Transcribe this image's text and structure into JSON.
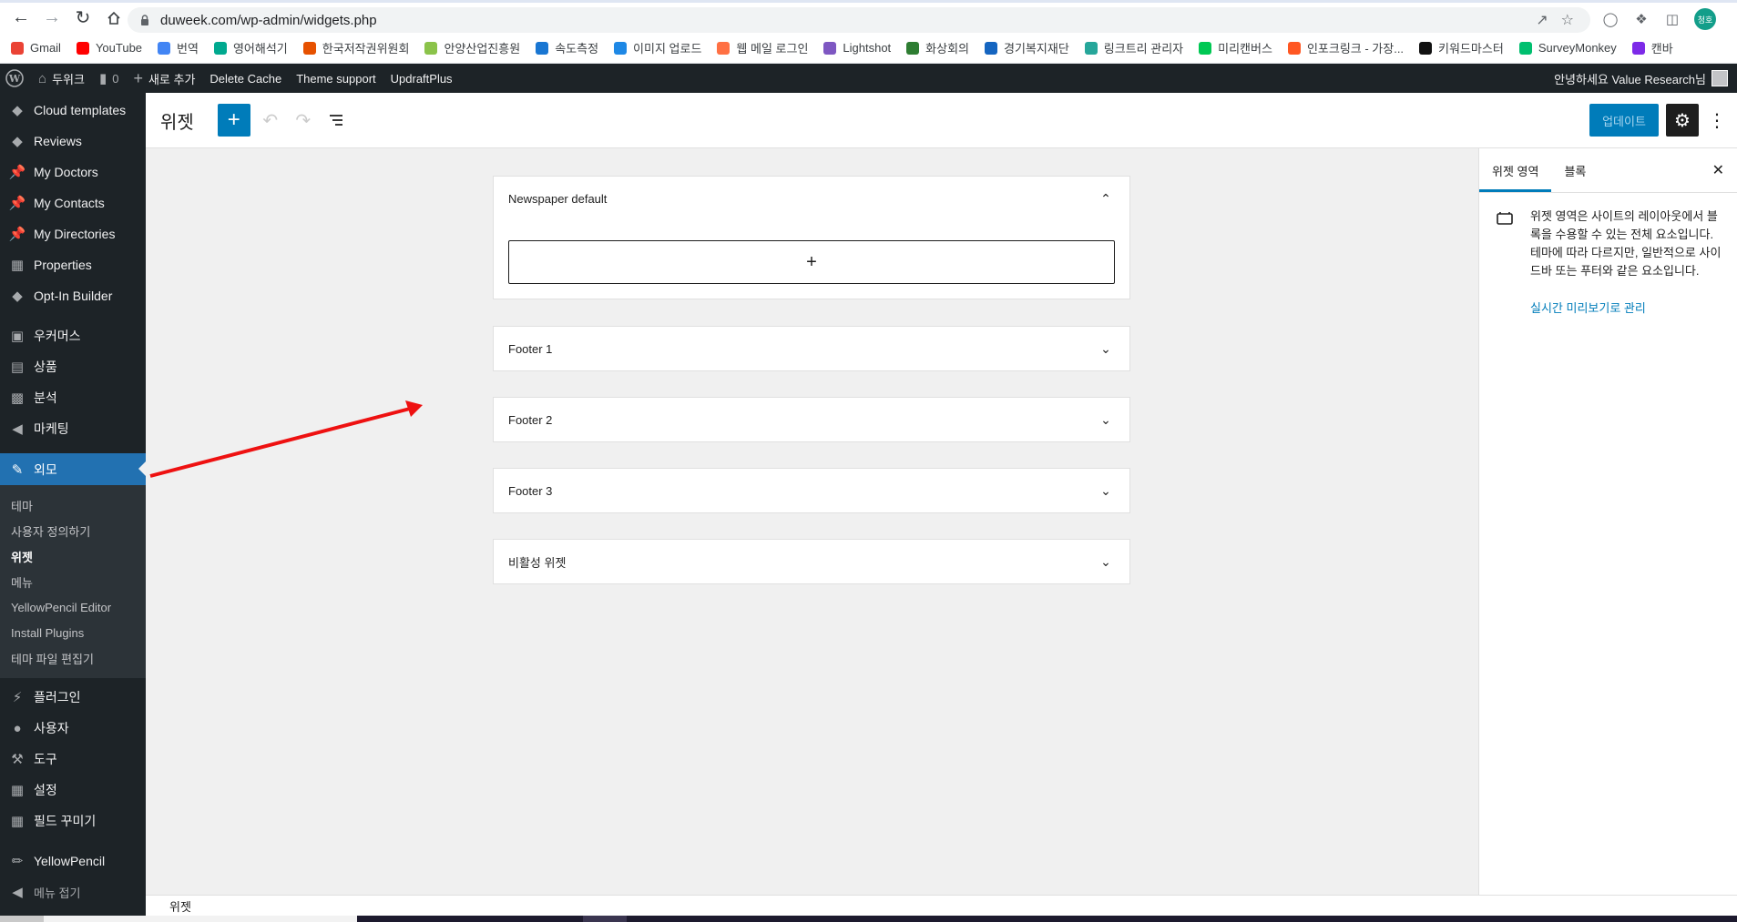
{
  "browser": {
    "url": "duweek.com/wp-admin/widgets.php",
    "bookmarks": [
      "Gmail",
      "YouTube",
      "번역",
      "영어해석기",
      "한국저작권위원회",
      "안양산업진흥원",
      "속도측정",
      "이미지 업로드",
      "웹 메일 로그인",
      "Lightshot",
      "화상회의",
      "경기복지재단",
      "링크트리 관리자",
      "미리캔버스",
      "인포크링크 - 가장...",
      "키워드마스터",
      "SurveyMonkey",
      "캔바"
    ],
    "bookmark_colors": [
      "#ea4335",
      "#ff0000",
      "#4285f4",
      "#00a98f",
      "#e65100",
      "#8bc34a",
      "#1976d2",
      "#1e88e5",
      "#ff7043",
      "#7e57c2",
      "#2e7d32",
      "#1565c0",
      "#26a69a",
      "#00c853",
      "#ff5722",
      "#111111",
      "#00bf6f",
      "#7d2ae8"
    ],
    "profile_initials": "청호"
  },
  "adminbar": {
    "site_name": "두위크",
    "comments": "0",
    "new": "새로 추가",
    "items": [
      "Delete Cache",
      "Theme support",
      "UpdraftPlus"
    ],
    "greeting": "안녕하세요 Value Research님"
  },
  "sidebar": {
    "top_items": [
      {
        "label": "Cloud templates",
        "icon": "diamond-icon"
      },
      {
        "label": "Reviews",
        "icon": "diamond-icon"
      },
      {
        "label": "My Doctors",
        "icon": "pin-icon"
      },
      {
        "label": "My Contacts",
        "icon": "pin-icon"
      },
      {
        "label": "My Directories",
        "icon": "pin-icon"
      },
      {
        "label": "Properties",
        "icon": "building-icon"
      },
      {
        "label": "Opt-In Builder",
        "icon": "diamond-icon"
      }
    ],
    "mid_items": [
      {
        "label": "우커머스",
        "icon": "woo-icon"
      },
      {
        "label": "상품",
        "icon": "archive-icon"
      },
      {
        "label": "분석",
        "icon": "chart-icon"
      },
      {
        "label": "마케팅",
        "icon": "megaphone-icon"
      }
    ],
    "active": {
      "label": "외모",
      "icon": "brush-icon"
    },
    "submenu": [
      "테마",
      "사용자 정의하기",
      "위젯",
      "메뉴",
      "YellowPencil Editor",
      "Install Plugins",
      "테마 파일 편집기"
    ],
    "submenu_current": "위젯",
    "bottom_items": [
      {
        "label": "플러그인",
        "icon": "plugin-icon"
      },
      {
        "label": "사용자",
        "icon": "user-icon"
      },
      {
        "label": "도구",
        "icon": "wrench-icon"
      },
      {
        "label": "설정",
        "icon": "settings-icon"
      },
      {
        "label": "필드 꾸미기",
        "icon": "table-icon"
      }
    ],
    "extra": {
      "label": "YellowPencil",
      "icon": "pencil-icon"
    },
    "collapse": "메뉴 접기"
  },
  "editor": {
    "title": "위젯",
    "update_label": "업데이트"
  },
  "widget_areas": [
    {
      "title": "Newspaper default",
      "expanded": true
    },
    {
      "title": "Footer 1",
      "expanded": false
    },
    {
      "title": "Footer 2",
      "expanded": false
    },
    {
      "title": "Footer 3",
      "expanded": false
    },
    {
      "title": "비활성 위젯",
      "expanded": false
    }
  ],
  "inspector": {
    "tabs": [
      "위젯 영역",
      "블록"
    ],
    "active_tab": "위젯 영역",
    "description": "위젯 영역은 사이트의 레이아웃에서 블록을 수용할 수 있는 전체 요소입니다. 테마에 따라 다르지만, 일반적으로 사이드바 또는 푸터와 같은 요소입니다.",
    "link": "실시간 미리보기로 관리"
  },
  "footer": {
    "breadcrumb": "위젯"
  },
  "colors": {
    "accent": "#007cba",
    "admin_dark": "#1d2327",
    "active_menu": "#2271b1",
    "annotation_arrow": "#ee1111"
  }
}
